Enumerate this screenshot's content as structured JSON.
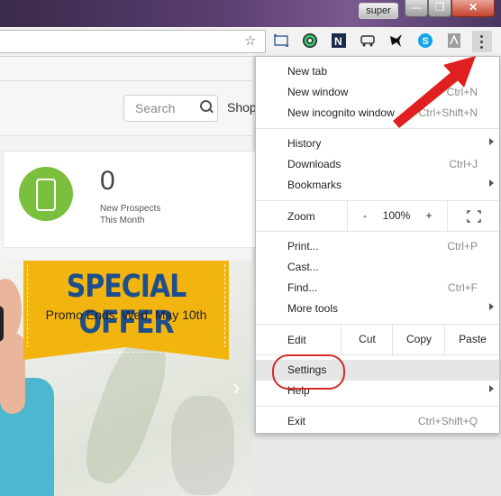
{
  "window": {
    "user_badge": "super",
    "min_glyph": "—",
    "max_glyph": "❐",
    "close_glyph": "✕"
  },
  "toolbar": {
    "bookmark_icon": "star-icon",
    "extensions": [
      "cast-icon",
      "color-wheel-icon",
      "n-extension-icon",
      "bus-icon",
      "bird-icon",
      "skype-icon",
      "pdf-icon"
    ],
    "menu_icon": "three-dots-icon"
  },
  "page": {
    "search_placeholder": "Search",
    "shop_label": "Shop",
    "prospects_count": "0",
    "prospects_label_line1": "New Prospects",
    "prospects_label_line2": "This Month",
    "offer_title": "SPECIAL OFFER",
    "offer_subtitle": "Promo Ends: Wed, May 10th",
    "next_glyph": "›"
  },
  "menu": {
    "new_tab": "New tab",
    "new_window": "New window",
    "new_window_sc": "Ctrl+N",
    "new_incognito": "New incognito window",
    "new_incognito_sc": "Ctrl+Shift+N",
    "history": "History",
    "downloads": "Downloads",
    "downloads_sc": "Ctrl+J",
    "bookmarks": "Bookmarks",
    "zoom": "Zoom",
    "zoom_minus": "-",
    "zoom_value": "100%",
    "zoom_plus": "+",
    "fullscreen_icon": "fullscreen-icon",
    "print": "Print...",
    "print_sc": "Ctrl+P",
    "cast": "Cast...",
    "find": "Find...",
    "find_sc": "Ctrl+F",
    "more_tools": "More tools",
    "edit": "Edit",
    "cut": "Cut",
    "copy": "Copy",
    "paste": "Paste",
    "settings": "Settings",
    "help": "Help",
    "exit": "Exit",
    "exit_sc": "Ctrl+Shift+Q"
  },
  "annotations": {
    "highlight_color": "#d42a2a",
    "arrow_color": "#e02020"
  }
}
